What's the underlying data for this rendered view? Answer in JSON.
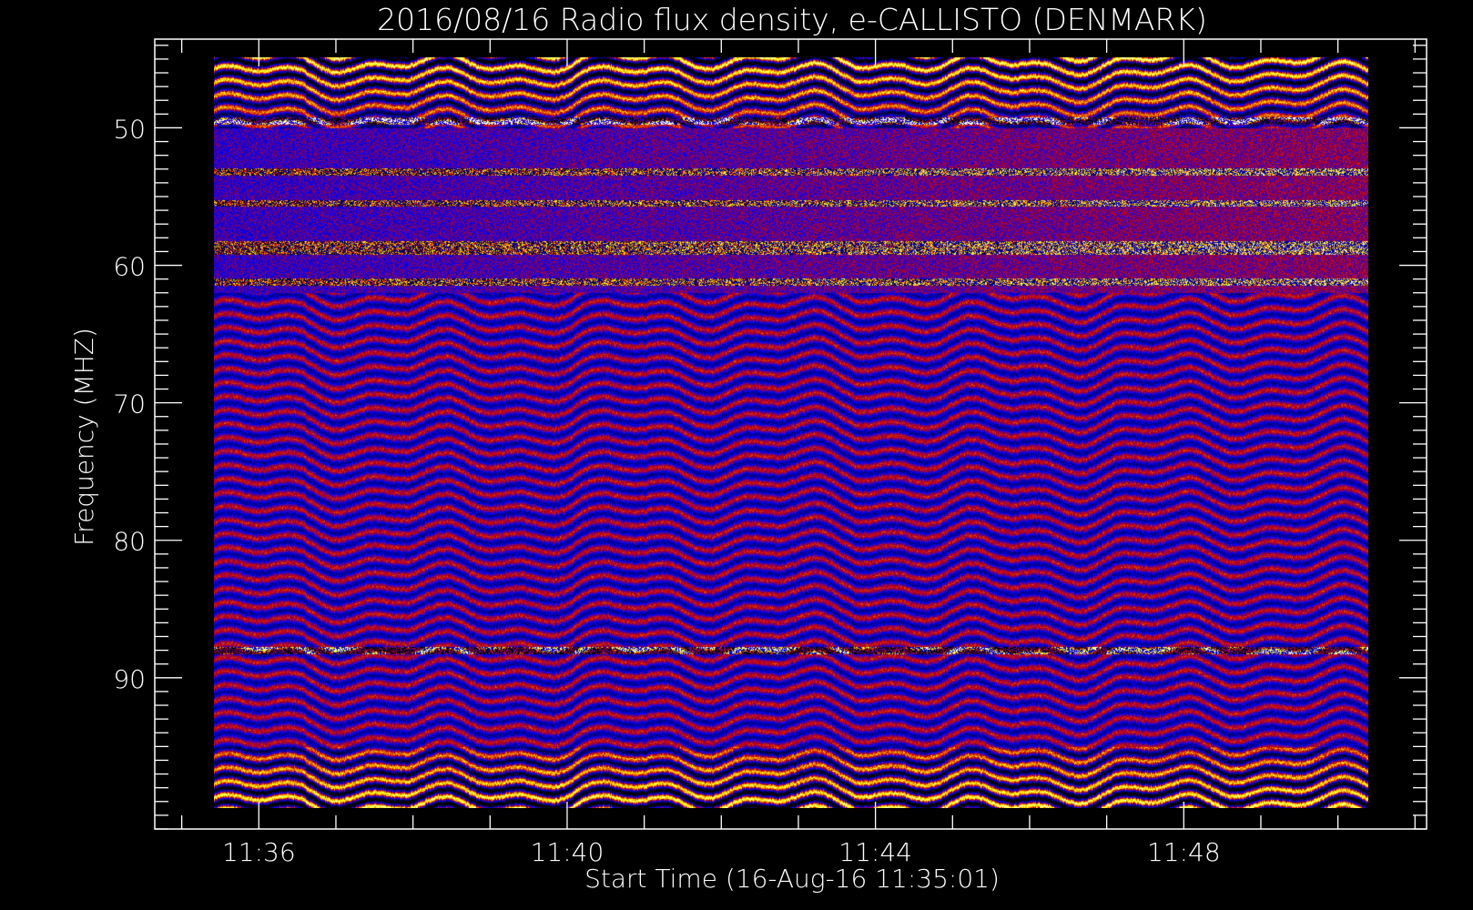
{
  "chart_data": {
    "type": "heatmap",
    "title": "2016/08/16  Radio flux density, e-CALLISTO (DENMARK)",
    "xlabel": "Start Time (16-Aug-16 11:35:01)",
    "ylabel": "Frequency (MHZ)",
    "x_unit": "minutes after 11:00 UT",
    "xlim": [
      34.65,
      51.15
    ],
    "ylim": [
      101.0,
      43.55
    ],
    "x_data_range": [
      35.42,
      50.4
    ],
    "y_data_range": [
      44.9,
      99.5
    ],
    "x_ticks": [
      {
        "value": 36,
        "label": "11:36"
      },
      {
        "value": 40,
        "label": "11:40"
      },
      {
        "value": 44,
        "label": "11:44"
      },
      {
        "value": 48,
        "label": "11:48"
      }
    ],
    "x_minor_step": 1,
    "y_ticks": [
      {
        "value": 50,
        "label": "50"
      },
      {
        "value": 60,
        "label": "60"
      },
      {
        "value": 70,
        "label": "70"
      },
      {
        "value": 80,
        "label": "80"
      },
      {
        "value": 90,
        "label": "90"
      }
    ],
    "y_minor_step": 1,
    "colormap": [
      "#000000",
      "#0000ff",
      "#d00000",
      "#ffff00",
      "#ffffff"
    ],
    "interference_bands_mhz": [
      49.5,
      53.2,
      55.5,
      58.5,
      59,
      61.2,
      88
    ],
    "grid": false
  }
}
